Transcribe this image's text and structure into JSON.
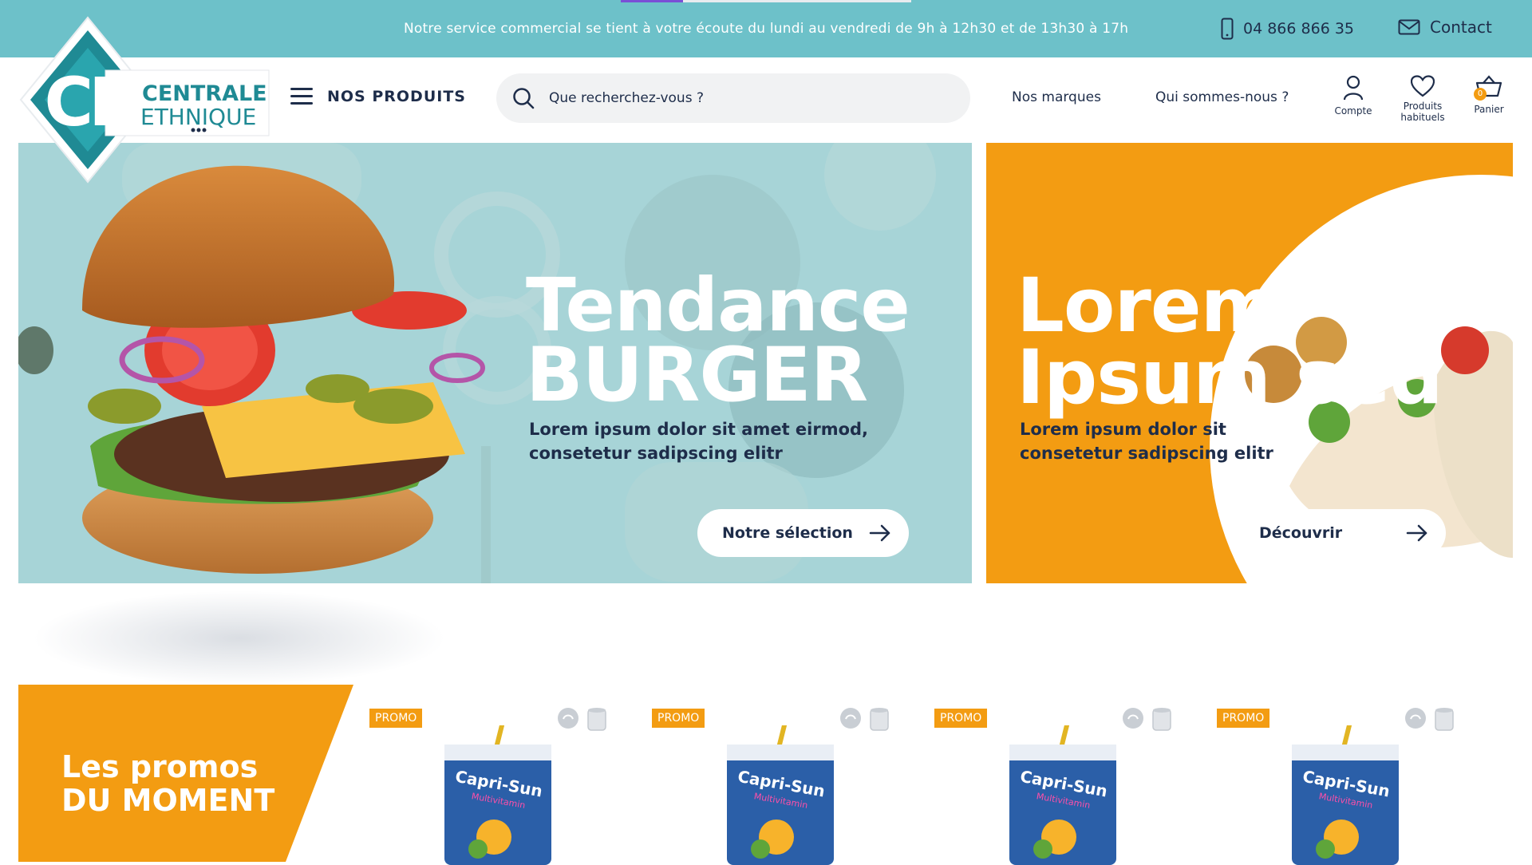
{
  "topbar": {
    "message": "Notre service commercial se tient à votre écoute du lundi au vendredi  de 9h à 12h30 et de 13h30 à 17h",
    "phone": "04 866 866 35",
    "contact_label": "Contact",
    "phone_icon": "phone-icon",
    "contact_icon": "mail-icon"
  },
  "logo": {
    "initials": "CE",
    "line1": "CENTRALE",
    "line2": "ETHNIQUE"
  },
  "header": {
    "menu_label": "NOS PRODUITS",
    "search_placeholder": "Que recherchez-vous ?",
    "nav": [
      "Nos marques",
      "Qui sommes-nous ?"
    ],
    "account_label": "Compte",
    "favorites_label": "Produits habituels",
    "cart_label": "Panier",
    "cart_count": "0"
  },
  "hero_main": {
    "title_line1": "Tendance",
    "title_line2": "BURGER",
    "subtitle": "Lorem ipsum dolor sit amet eirmod, consetetur sadipscing elitr",
    "button_label": "Notre sélection"
  },
  "hero_side": {
    "title_line1": "Lorem",
    "title_line2": "Ipsum sed",
    "subtitle": "Lorem ipsum dolor sit consetetur sadipscing elitr",
    "button_label": "Découvrir"
  },
  "promos": {
    "title_line1": "Les promos",
    "title_line2": "DU MOMENT",
    "products": [
      {
        "badge": "PROMO",
        "brand": "Capri-Sun",
        "variant": "Multivitamin"
      },
      {
        "badge": "PROMO",
        "brand": "Capri-Sun",
        "variant": "Multivitamin"
      },
      {
        "badge": "PROMO",
        "brand": "Capri-Sun",
        "variant": "Multivitamin"
      },
      {
        "badge": "PROMO",
        "brand": "Capri-Sun",
        "variant": "Multivitamin"
      }
    ]
  },
  "colors": {
    "teal": "#6dc1c9",
    "navy": "#1e2d4a",
    "orange": "#f39c12",
    "logo_teal": "#1f8a94"
  }
}
